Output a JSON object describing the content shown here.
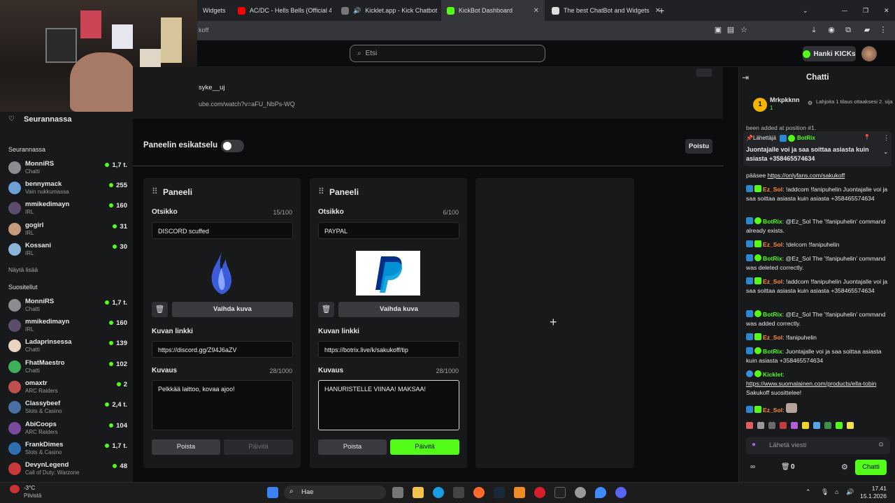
{
  "browser": {
    "tabs": [
      {
        "label": "Widgets"
      },
      {
        "label": "AC/DC - Hells Bells (Official 4K"
      },
      {
        "label": "Kicklet.app - Kick Chatbot"
      },
      {
        "label": "KickBot Dashboard"
      },
      {
        "label": "The best ChatBot and Widgets"
      }
    ],
    "address_fragment": "koff"
  },
  "topnav": {
    "search_placeholder": "Etsi",
    "kicks_label": "Hanki KICKs"
  },
  "preview": {
    "user_partial": "syke__uj",
    "url_partial": "ube.com/watch?v=aFU_NbPs-WQ"
  },
  "sidebar": {
    "following_title": "Seurannassa",
    "following_heading": "Seurannassa",
    "following": [
      {
        "name": "MonniRS",
        "sub": "Chatti",
        "count": "1,7 t."
      },
      {
        "name": "bennymack",
        "sub": "Vain nukkumassa",
        "count": "255"
      },
      {
        "name": "mmikedimayn",
        "sub": "IRL",
        "count": "160"
      },
      {
        "name": "gogirl",
        "sub": "IRL",
        "count": "31"
      },
      {
        "name": "Kossani",
        "sub": "IRL",
        "count": "30"
      }
    ],
    "show_more": "Näytä lisää",
    "recommended_heading": "Suositellut",
    "recommended": [
      {
        "name": "MonniRS",
        "sub": "Chatti",
        "count": "1,7 t."
      },
      {
        "name": "mmikedimayn",
        "sub": "IRL",
        "count": "160"
      },
      {
        "name": "Ladaprinsessa",
        "sub": "Chatti",
        "count": "139"
      },
      {
        "name": "FhatMaestro",
        "sub": "Chatti",
        "count": "102"
      },
      {
        "name": "omaxtr",
        "sub": "ARC Raiders",
        "count": "2"
      },
      {
        "name": "Classybeef",
        "sub": "Slots & Casino",
        "count": "2,4 t."
      },
      {
        "name": "AbiCoops",
        "sub": "ARC Raiders",
        "count": "104"
      },
      {
        "name": "FrankDimes",
        "sub": "Slots & Casino",
        "count": "1,7 t."
      },
      {
        "name": "DevynLegend",
        "sub": "Call of Duty: Warzone",
        "count": "48"
      }
    ]
  },
  "panels": {
    "preview_toggle_label": "Paneelin esikatselu",
    "exit_label": "Poistu",
    "items": [
      {
        "title": "Paneeli",
        "heading_label": "Otsikko",
        "heading_count": "15/100",
        "heading_value": "DISCORD scuffed",
        "change_image": "Vaihda kuva",
        "link_label": "Kuvan linkki",
        "link_value": "https://discord.gg/Z94J6aZV",
        "desc_label": "Kuvaus",
        "desc_count": "28/1000",
        "desc_value": "Pelkkää laittoo, kovaa ajoo!",
        "delete_label": "Poista",
        "update_label": "Päivitä"
      },
      {
        "title": "Paneeli",
        "heading_label": "Otsikko",
        "heading_count": "6/100",
        "heading_value": "PAYPAL",
        "change_image": "Vaihda kuva",
        "link_label": "Kuvan linkki",
        "link_value": "https://botrix.live/k/sakukoff/tip",
        "desc_label": "Kuvaus",
        "desc_count": "28/1000",
        "desc_value": "HANURISTELLE VIINAA! MAKSAA!",
        "delete_label": "Poista",
        "update_label": "Päivitä"
      }
    ]
  },
  "chat": {
    "title": "Chatti",
    "top_gifter": {
      "rank": "1",
      "name": "Mrkpkknn",
      "amount": "1",
      "note": "Lahjoita 1 tilaus ottaaksesi 2. sija"
    },
    "pinned_partial": "been added at position #1.",
    "pinned": {
      "sender_label": "Lähettäjä",
      "sender": "BotRix",
      "text": "Juontajalle voi ja saa soittaa asiasta kuin asiasta +358465574634"
    },
    "messages": [
      {
        "user": "",
        "text": "pääsee ",
        "link": "https://onlyfans.com/sakukoff"
      },
      {
        "user": "Ez_Sol",
        "text": "!addcom !fanipuhelin Juontajalle voi ja saa soittaa asiasta kuin asiasta +358465574634"
      },
      {
        "user": "BotRix",
        "text": "@Ez_Sol The '!fanipuhelin' command already exists."
      },
      {
        "user": "Ez_Sol",
        "text": "!delcom !fanipuhelin"
      },
      {
        "user": "BotRix",
        "text": "@Ez_Sol The '!fanipuhelin' command was deleted correctly."
      },
      {
        "user": "Ez_Sol",
        "text": "!addcom !fanipuhelin Juontajalle voi ja saa soittaa asiasta kuin asiasta +358465574634"
      },
      {
        "user": "BotRix",
        "text": "@Ez_Sol The '!fanipuhelin' command was added correctly."
      },
      {
        "user": "Ez_Sol",
        "text": "!fanipuhelin"
      },
      {
        "user": "BotRix",
        "text": "Juontajalle voi ja saa soittaa asiasta kuin asiasta +358465574634"
      },
      {
        "user": "Kicklet",
        "text": "",
        "link": "https://www.suomalainen.com/products/ella-tobin",
        "after": "Sakukoff suosittelee!"
      },
      {
        "user": "Ez_Sol",
        "text": ""
      }
    ],
    "input_placeholder": "Lähetä viesti",
    "points": "0",
    "send_label": "Chatti"
  },
  "taskbar": {
    "weather_temp": "-3°C",
    "weather_desc": "Pilvistä",
    "search_label": "Hae",
    "time": "17.41",
    "date": "15.1.2026"
  },
  "colors": {
    "accent": "#53fc18",
    "bg": "#0b0c0d",
    "panel": "#18191b"
  }
}
